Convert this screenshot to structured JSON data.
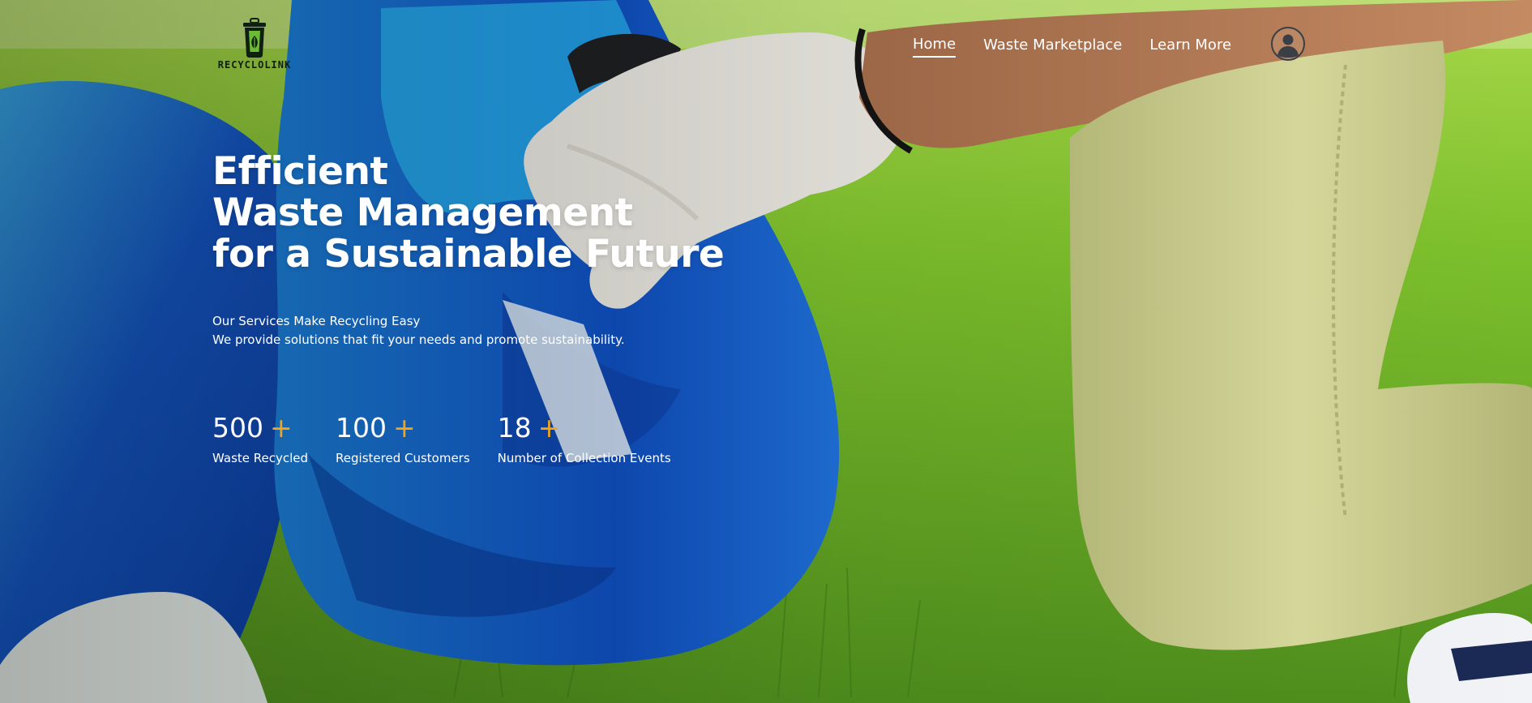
{
  "brand": {
    "logo_text": "RECYCLOLINK",
    "accent_color": "#f0a51c"
  },
  "nav": {
    "items": [
      {
        "label": "Home",
        "active": true
      },
      {
        "label": "Waste Marketplace",
        "active": false
      },
      {
        "label": "Learn More",
        "active": false
      }
    ],
    "profile_icon": "user-profile-icon"
  },
  "hero": {
    "headline_lines": [
      "Efficient",
      "Waste Management",
      "for a Sustainable Future"
    ],
    "subtitle_lines": [
      "Our Services Make Recycling Easy",
      "We provide solutions that fit your needs and promote sustainability."
    ],
    "stats": [
      {
        "number": "500",
        "suffix": "+",
        "label": "Waste Recycled"
      },
      {
        "number": "100",
        "suffix": "+",
        "label": "Registered Customers"
      },
      {
        "number": "18",
        "suffix": "+",
        "label": "Number of Collection Events"
      }
    ]
  }
}
